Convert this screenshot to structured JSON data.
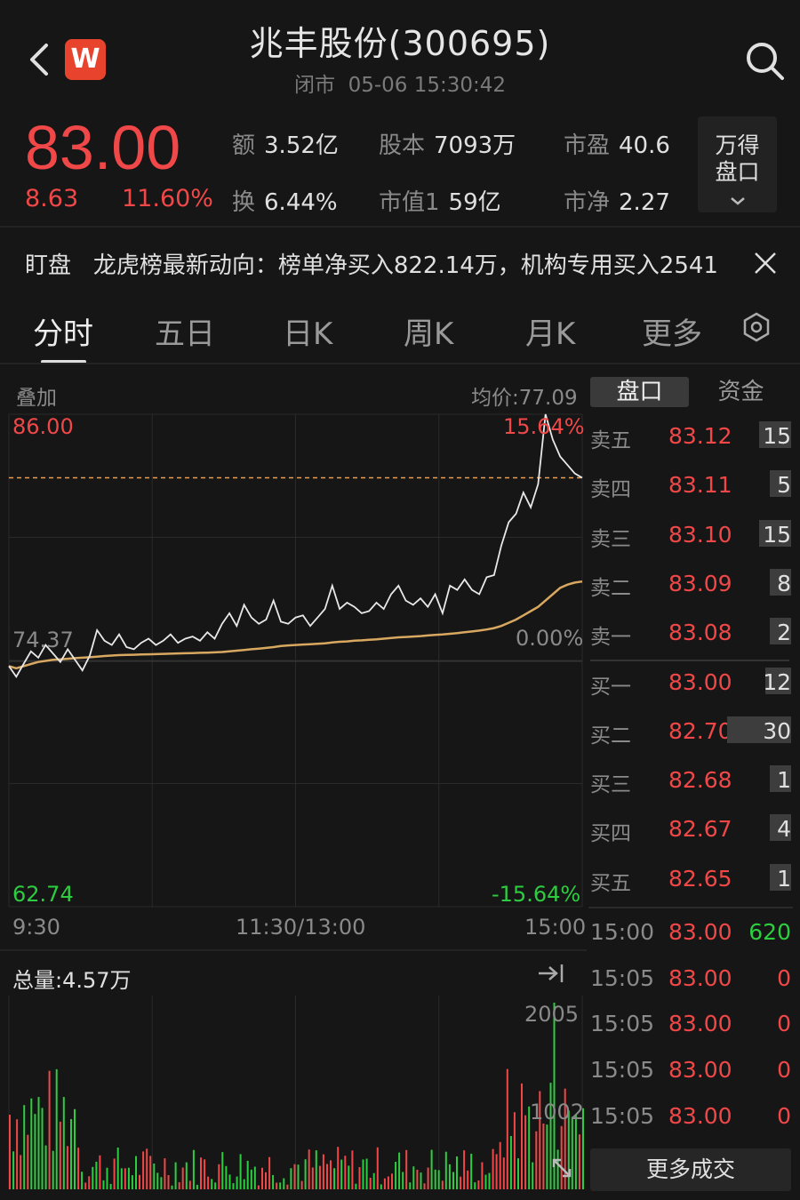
{
  "header": {
    "title": "兆丰股份(300695)",
    "status": "闭市",
    "datetime": "05-06 15:30:42",
    "logo_text": "W",
    "back_icon": "chevron-left-icon",
    "search_icon": "search-icon"
  },
  "quote": {
    "price": "83.00",
    "change": "8.63",
    "change_pct": "11.60%",
    "stats": [
      {
        "key": "额",
        "value": "3.52亿"
      },
      {
        "key": "股本",
        "value": "7093万"
      },
      {
        "key": "市盈",
        "value": "40.6"
      },
      {
        "key": "换",
        "value": "6.44%"
      },
      {
        "key": "市值1",
        "value": "59亿"
      },
      {
        "key": "市净",
        "value": "2.27"
      }
    ],
    "wd_button": [
      "万得",
      "盘口"
    ]
  },
  "news": {
    "label": "盯盘",
    "text": "龙虎榜最新动向：榜单净买入822.14万，机构专用买入2541"
  },
  "tabs": [
    "分时",
    "五日",
    "日K",
    "周K",
    "月K",
    "更多"
  ],
  "chart_header": {
    "overlay": "叠加",
    "avg_price": "均价:77.09",
    "segments": [
      "盘口",
      "资金"
    ]
  },
  "chart_data": {
    "type": "line",
    "y_axis": {
      "top": "86.00",
      "mid": "74.37",
      "bottom": "62.74"
    },
    "pct_axis": {
      "top": "15.64%",
      "mid": "0.00%",
      "bottom": "-15.64%"
    },
    "x_labels": [
      "9:30",
      "11:30/13:00",
      "15:00"
    ],
    "ylim": [
      62.74,
      86.0
    ],
    "prev_close": 74.37,
    "current_price": 83.0,
    "series": [
      {
        "values": [
          74.1,
          73.6,
          74.2,
          74.8,
          74.5,
          75.1,
          74.7,
          74.3,
          74.9,
          74.4,
          73.9,
          74.6,
          75.8,
          75.3,
          75.1,
          75.6,
          75.0,
          74.9,
          75.2,
          75.4,
          75.1,
          75.3,
          75.6,
          75.2,
          75.4,
          75.5,
          75.3,
          75.7,
          75.4,
          76.1,
          76.6,
          76.0,
          77.0,
          76.4,
          76.1,
          76.3,
          77.2,
          76.2,
          76.1,
          76.4,
          76.5,
          76.0,
          76.4,
          76.8,
          77.9,
          76.8,
          77.1,
          76.9,
          76.6,
          76.7,
          77.1,
          76.8,
          77.5,
          77.9,
          77.2,
          77.0,
          77.3,
          76.9,
          77.5,
          76.6,
          77.9,
          77.7,
          78.2,
          77.7,
          77.5,
          78.3,
          78.4,
          79.8,
          80.9,
          81.3,
          82.3,
          81.6,
          82.7,
          86.0,
          84.8,
          84.0,
          83.6,
          83.2,
          83.0
        ]
      },
      {
        "values": [
          74.1,
          74.0,
          74.1,
          74.2,
          74.3,
          74.35,
          74.4,
          74.42,
          74.45,
          74.48,
          74.5,
          74.52,
          74.55,
          74.58,
          74.6,
          74.62,
          74.63,
          74.64,
          74.65,
          74.66,
          74.67,
          74.68,
          74.69,
          74.7,
          74.71,
          74.72,
          74.73,
          74.74,
          74.75,
          74.77,
          74.8,
          74.83,
          74.86,
          74.9,
          74.93,
          74.96,
          75.0,
          75.05,
          75.08,
          75.1,
          75.12,
          75.14,
          75.16,
          75.18,
          75.22,
          75.25,
          75.27,
          75.3,
          75.32,
          75.35,
          75.37,
          75.4,
          75.43,
          75.46,
          75.48,
          75.5,
          75.52,
          75.55,
          75.58,
          75.6,
          75.63,
          75.66,
          75.7,
          75.74,
          75.78,
          75.83,
          75.9,
          76.0,
          76.15,
          76.3,
          76.5,
          76.7,
          76.9,
          77.2,
          77.5,
          77.8,
          77.95,
          78.05,
          78.1
        ]
      }
    ]
  },
  "volume": {
    "total": "总量:4.57万",
    "max_label": "2005",
    "mid_label": "1002"
  },
  "order_book": {
    "asks": [
      {
        "label": "卖五",
        "price": "83.12",
        "vol": "15"
      },
      {
        "label": "卖四",
        "price": "83.11",
        "vol": "5"
      },
      {
        "label": "卖三",
        "price": "83.10",
        "vol": "15"
      },
      {
        "label": "卖二",
        "price": "83.09",
        "vol": "8"
      },
      {
        "label": "卖一",
        "price": "83.08",
        "vol": "2"
      }
    ],
    "bids": [
      {
        "label": "买一",
        "price": "83.00",
        "vol": "12"
      },
      {
        "label": "买二",
        "price": "82.70",
        "vol": "30"
      },
      {
        "label": "买三",
        "price": "82.68",
        "vol": "1"
      },
      {
        "label": "买四",
        "price": "82.67",
        "vol": "4"
      },
      {
        "label": "买五",
        "price": "82.65",
        "vol": "1"
      }
    ]
  },
  "trades": [
    {
      "time": "15:00",
      "price": "83.00",
      "vol": "620",
      "color": "#2ecc40"
    },
    {
      "time": "15:05",
      "price": "83.00",
      "vol": "0",
      "color": "#f04848"
    },
    {
      "time": "15:05",
      "price": "83.00",
      "vol": "0",
      "color": "#f04848"
    },
    {
      "time": "15:05",
      "price": "83.00",
      "vol": "0",
      "color": "#f04848"
    },
    {
      "time": "15:05",
      "price": "83.00",
      "vol": "0",
      "color": "#f04848"
    }
  ],
  "more_trades": "更多成交",
  "colors": {
    "up": "#f04848",
    "down": "#2ecc40",
    "avg": "#d8a860",
    "price_line": "#e8e8e8"
  }
}
